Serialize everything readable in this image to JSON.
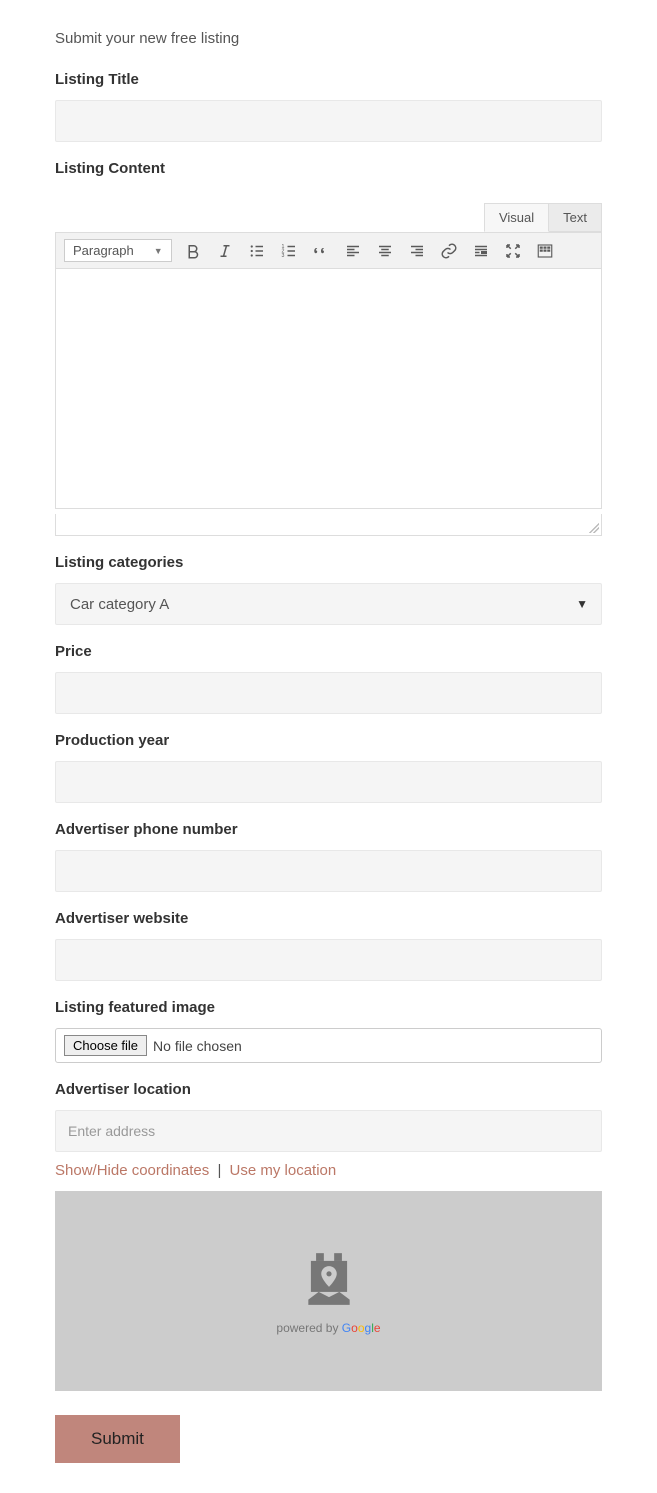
{
  "intro": "Submit your new free listing",
  "labels": {
    "title": "Listing Title",
    "content": "Listing Content",
    "categories": "Listing categories",
    "price": "Price",
    "production_year": "Production year",
    "phone": "Advertiser phone number",
    "website": "Advertiser website",
    "featured_image": "Listing featured image",
    "location": "Advertiser location"
  },
  "editor": {
    "tabs": {
      "visual": "Visual",
      "text": "Text"
    },
    "paragraph": "Paragraph"
  },
  "category_selected": "Car category A",
  "file": {
    "button": "Choose file",
    "status": "No file chosen"
  },
  "location": {
    "placeholder": "Enter address",
    "show_hide": "Show/Hide coordinates",
    "use_my_location": "Use my location",
    "powered_by": "powered by "
  },
  "submit": "Submit"
}
